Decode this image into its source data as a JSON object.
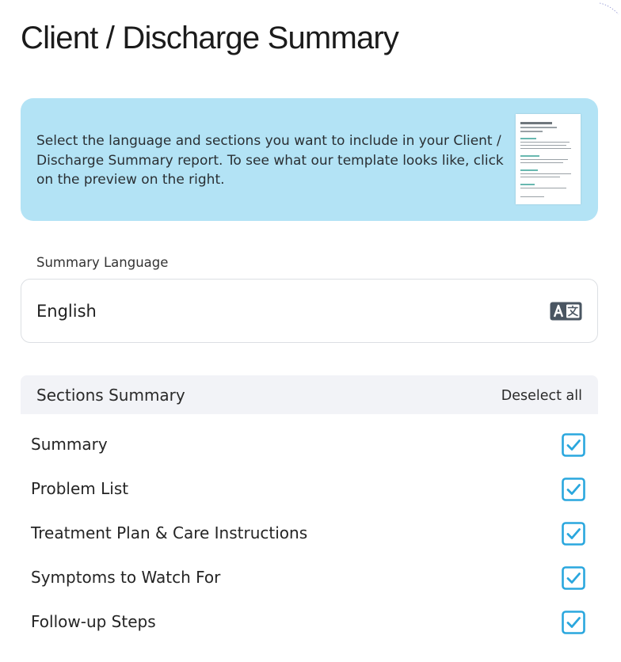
{
  "page": {
    "title": "Client / Discharge Summary"
  },
  "banner": {
    "text": "Select the language and sections you want to include in your Client / Discharge Summary report. To see what our template looks like, click on the preview on the right.",
    "background": "#b3e3f5",
    "preview_icon": "template-preview-thumbnail"
  },
  "language": {
    "label": "Summary Language",
    "value": "English",
    "icon": "translate-icon"
  },
  "sections": {
    "title": "Sections Summary",
    "deselect_label": "Deselect all",
    "accent": "#2aa7de",
    "items": [
      {
        "label": "Summary",
        "checked": true
      },
      {
        "label": "Problem List",
        "checked": true
      },
      {
        "label": "Treatment Plan & Care Instructions",
        "checked": true
      },
      {
        "label": "Symptoms to Watch For",
        "checked": true
      },
      {
        "label": "Follow-up Steps",
        "checked": true
      }
    ]
  }
}
